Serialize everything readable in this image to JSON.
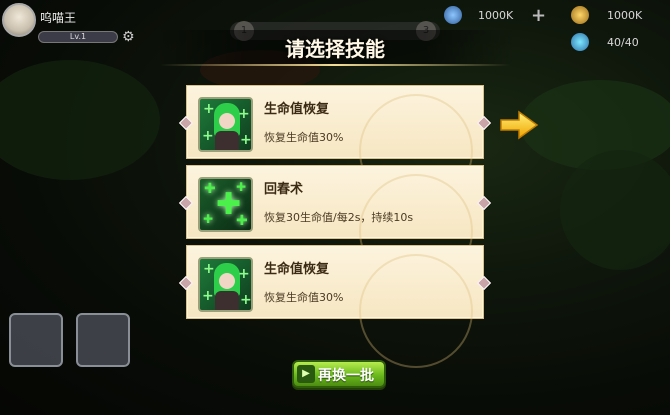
{
  "player": {
    "name": "呜喵王",
    "level": "Lv.1"
  },
  "stage": {
    "left_dot": "1",
    "right_dot": "3"
  },
  "resources": {
    "crystal": "1000K",
    "coin": "1000K",
    "stamina": "40/40"
  },
  "title": "请选择技能",
  "cards": [
    {
      "name": "生命值恢复",
      "desc": "恢复生命值30%",
      "icon": "hero-heal-icon"
    },
    {
      "name": "回春术",
      "desc": "恢复30生命值/每2s，持续10s",
      "icon": "green-cross-heal-icon"
    },
    {
      "name": "生命值恢复",
      "desc": "恢复生命值30%",
      "icon": "hero-heal-icon"
    }
  ],
  "refresh_label": "再换一批",
  "colors": {
    "card_bg": "#f6e6c2",
    "button_green": "#6ab91d",
    "arrow_yellow": "#f5c315"
  }
}
